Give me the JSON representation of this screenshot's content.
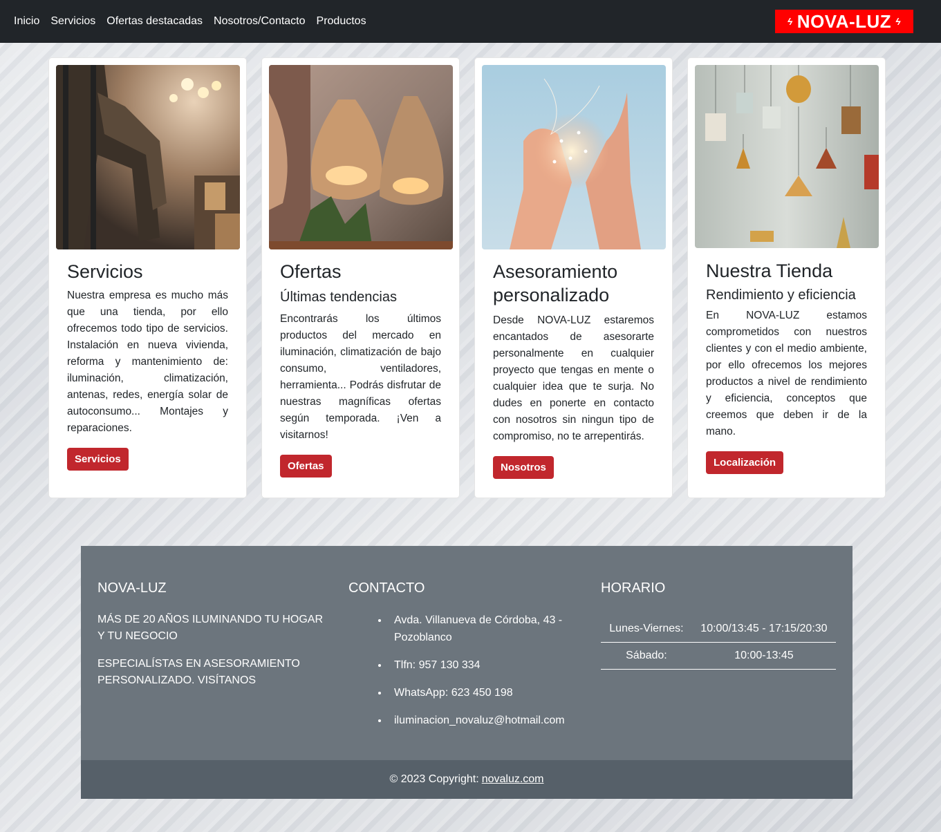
{
  "nav": {
    "links": [
      "Inicio",
      "Servicios",
      "Ofertas destacadas",
      "Nosotros/Contacto",
      "Productos"
    ],
    "brand": "NOVA-LUZ"
  },
  "cards": [
    {
      "image": "electrician-on-ladder-photo",
      "title": "Servicios",
      "subtitle": "",
      "text": "Nuestra empresa es mucho más que una tienda, por ello ofrecemos todo tipo de servicios. Instalación en nueva vivienda, reforma y mantenimiento de: iluminación, climatización, antenas, redes, energía solar de autoconsumo... Montajes y reparaciones.",
      "button": "Servicios"
    },
    {
      "image": "wicker-pendant-lamps-photo",
      "title": "Ofertas",
      "subtitle": "Últimas tendencias",
      "text": "Encontrarás los últimos productos del mercado en iluminación, climatización de bajo consumo, ventiladores, herramienta... Podrás disfrutar de nuestras magníficas ofertas según temporada. ¡Ven a visitarnos!",
      "button": "Ofertas"
    },
    {
      "image": "hands-holding-fairy-lights-photo",
      "title": "Asesoramiento personalizado",
      "subtitle": "",
      "text": "Desde NOVA-LUZ estaremos encantados de asesorarte personalmente en cualquier proyecto que tengas en mente o cualquier idea que te surja. No dudes en ponerte en contacto con nosotros sin ningun tipo de compromiso, no te arrepentirás.",
      "button": "Nosotros"
    },
    {
      "image": "shop-pendant-lamps-display-photo",
      "title": "Nuestra Tienda",
      "subtitle": "Rendimiento y eficiencia",
      "text": "En NOVA-LUZ estamos comprometidos con nuestros clientes y con el medio ambiente, por ello ofrecemos los mejores productos a nivel de rendimiento y eficiencia, conceptos que creemos que deben ir de la mano.",
      "button": "Localización"
    }
  ],
  "footer": {
    "about": {
      "heading": "NOVA-LUZ",
      "lines": [
        "Más de 20 años iluminando tu hogar y tu negocio",
        "Especialístas en asesoramiento personalizado. Visítanos"
      ]
    },
    "contact": {
      "heading": "CONTACTO",
      "items": [
        "Avda. Villanueva de Córdoba, 43 - Pozoblanco",
        "Tlfn: 957 130 334",
        "WhatsApp: 623 450 198",
        "iluminacion_novaluz@hotmail.com"
      ]
    },
    "hours": {
      "heading": "HORARIO",
      "rows": [
        {
          "day": "Lunes-Viernes:",
          "time": "10:00/13:45 - 17:15/20:30"
        },
        {
          "day": "Sábado:",
          "time": "10:00-13:45"
        }
      ]
    },
    "copyright": {
      "text": "© 2023 Copyright:",
      "link": "novaluz.com"
    }
  },
  "colors": {
    "navbar": "#212529",
    "brand": "#ff0000",
    "button": "#c1272d",
    "footer": "#6c757d",
    "copyright_bar": "#566069"
  }
}
